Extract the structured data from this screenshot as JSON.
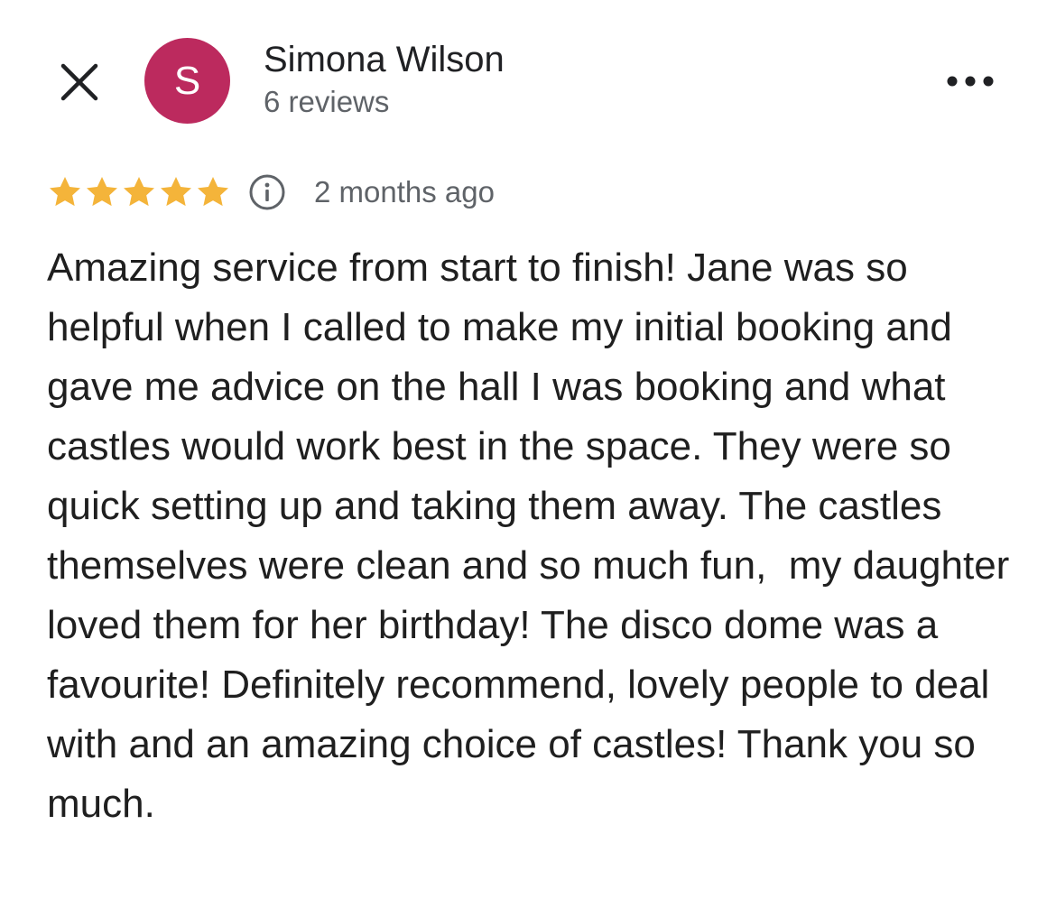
{
  "header": {
    "close_icon": "close-icon",
    "more_icon": "more-horizontal-icon"
  },
  "reviewer": {
    "avatar_initial": "S",
    "avatar_color": "#bc2a5e",
    "name": "Simona Wilson",
    "review_count": "6 reviews"
  },
  "review": {
    "rating": 5,
    "rating_max": 5,
    "star_color": "#f4b43a",
    "info_icon": "info-icon",
    "timestamp": "2 months ago",
    "text": "Amazing service from start to finish! Jane was so helpful when I called to make my initial booking and gave me advice on the hall I was booking and what castles would work best in the space. They were so quick setting up and taking them away. The castles themselves were clean and so much fun,  my daughter loved them for her birthday! The disco dome was a favourite! Definitely recommend, lovely people to deal with and an amazing choice of castles! Thank you so much."
  }
}
